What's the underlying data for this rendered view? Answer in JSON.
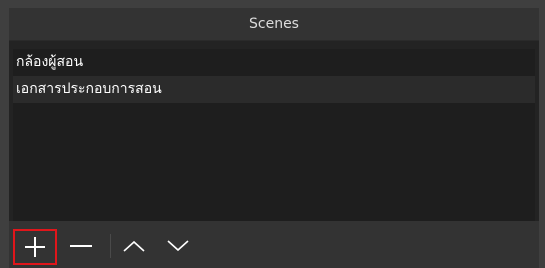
{
  "panel": {
    "title": "Scenes"
  },
  "scenes": [
    {
      "label": "กล้องผู้สอน"
    },
    {
      "label": "เอกสารประกอบการสอน"
    }
  ],
  "toolbar": {
    "add_icon": "plus-icon",
    "remove_icon": "minus-icon",
    "up_icon": "chevron-up-icon",
    "down_icon": "chevron-down-icon",
    "highlight_color": "#e0161b"
  }
}
